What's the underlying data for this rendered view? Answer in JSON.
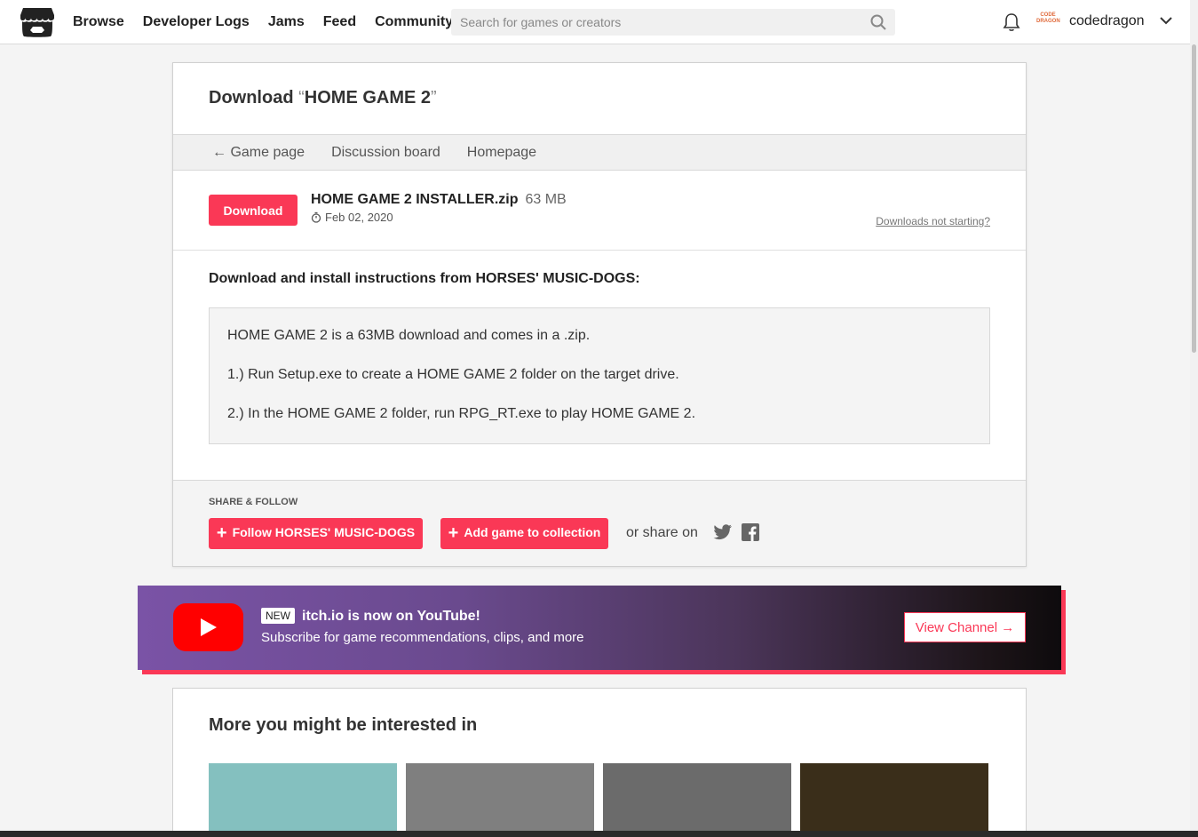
{
  "header": {
    "nav": [
      "Browse",
      "Developer Logs",
      "Jams",
      "Feed",
      "Community"
    ],
    "search_placeholder": "Search for games or creators",
    "username": "codedragon",
    "avatar_text": "CODE DRAGON"
  },
  "page": {
    "title_prefix": "Download",
    "open_quote": "“",
    "game_name": "HOME GAME 2",
    "close_quote": "”",
    "subnav": {
      "back_arrow": "←",
      "game_page": "Game page",
      "discussion": "Discussion board",
      "homepage": "Homepage"
    },
    "download": {
      "button": "Download",
      "filename": "HOME GAME 2 INSTALLER.zip",
      "size": "63 MB",
      "date": "Feb 02, 2020",
      "not_starting": "Downloads not starting?"
    },
    "instructions": {
      "heading": "Download and install instructions from HORSES' MUSIC-DOGS:",
      "lines": [
        "HOME GAME 2 is a 63MB download and comes in a .zip.",
        "1.) Run Setup.exe to create a HOME GAME 2 folder on the target drive.",
        "2.) In the HOME GAME 2 folder, run RPG_RT.exe to play HOME GAME 2."
      ]
    },
    "share": {
      "heading": "SHARE & FOLLOW",
      "follow": "Follow HORSES' MUSIC-DOGS",
      "add": "Add game to collection",
      "or_share": "or share on"
    }
  },
  "youtube": {
    "badge": "NEW",
    "title": "itch.io is now on YouTube!",
    "subtitle": "Subscribe for game recommendations, clips, and more",
    "button": "View Channel →"
  },
  "more": {
    "heading": "More you might be interested in",
    "thumb_colors": [
      "#84c0bf",
      "#7f7f7f",
      "#6b6b6b",
      "#3a2e1a"
    ]
  },
  "colors": {
    "accent": "#fa3856",
    "youtube_red": "#ff0000"
  }
}
